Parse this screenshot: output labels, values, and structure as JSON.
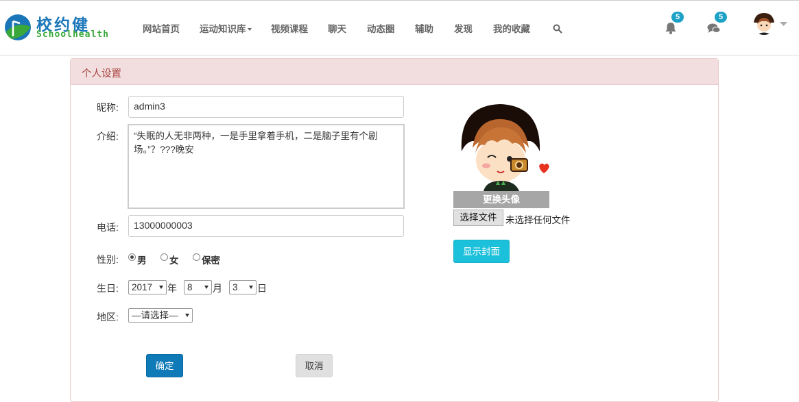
{
  "brand": {
    "logo_text": "校约健",
    "logo_sub": "Schoolhealth"
  },
  "nav": {
    "items": [
      "网站首页",
      "运动知识库",
      "视频课程",
      "聊天",
      "动态圈",
      "辅助",
      "发现",
      "我的收藏"
    ]
  },
  "header": {
    "notifications_count": "5",
    "messages_count": "5"
  },
  "panel": {
    "title": "个人设置"
  },
  "form": {
    "nickname_label": "昵称:",
    "nickname_value": "admin3",
    "intro_label": "介绍:",
    "intro_value": "“失眠的人无非两种，一是手里拿着手机，二是脑子里有个剧场。”？???晚安",
    "phone_label": "电话:",
    "phone_value": "13000000003",
    "gender_label": "性别:",
    "gender_options": [
      "男",
      "女",
      "保密"
    ],
    "gender_selected": "男",
    "birthday_label": "生日:",
    "birthday_year": "2017",
    "birthday_year_unit": "年",
    "birthday_month": "8",
    "birthday_month_unit": "月",
    "birthday_day": "3",
    "birthday_day_unit": "日",
    "region_label": "地区:",
    "region_value": "—请选择—",
    "confirm_label": "确定",
    "cancel_label": "取消"
  },
  "avatar_panel": {
    "change_label": "更换头像",
    "file_button_label": "选择文件",
    "file_status": "未选择任何文件",
    "show_cover_label": "显示封面"
  },
  "colors": {
    "brand_blue": "#1a76b8",
    "brand_green": "#38a83a",
    "badge": "#1da1c6",
    "panel_head_bg": "#f2dede",
    "panel_head_text": "#a94442",
    "primary_button": "#0f7ab8",
    "info_button": "#1bc0da"
  },
  "icons": [
    "logo-leaf-icon",
    "search-icon",
    "bell-icon",
    "comments-icon",
    "chevron-down-icon"
  ]
}
